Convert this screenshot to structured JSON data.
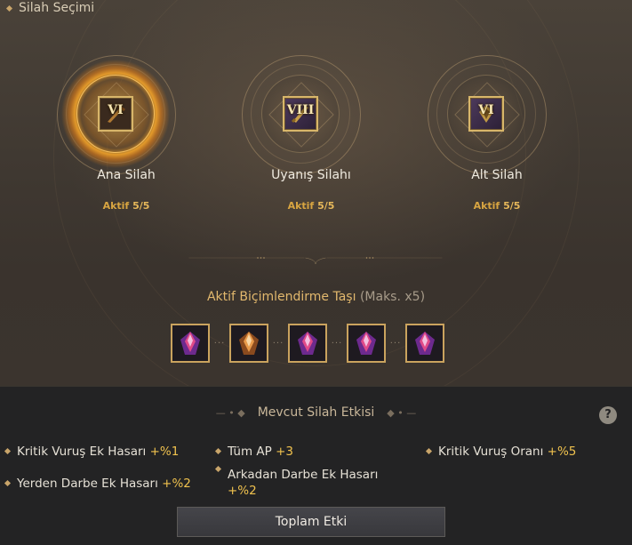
{
  "window": {
    "title": "Silah Seçimi"
  },
  "slots": [
    {
      "label": "Ana Silah",
      "grade": "VI",
      "status_prefix": "Aktif",
      "status_value": "5/5",
      "active": true
    },
    {
      "label": "Uyanış Silahı",
      "grade": "VIII",
      "status_prefix": "Aktif",
      "status_value": "5/5",
      "active": false
    },
    {
      "label": "Alt Silah",
      "grade": "VI",
      "status_prefix": "Aktif",
      "status_value": "5/5",
      "active": false
    }
  ],
  "stones": {
    "title": "Aktif Biçimlendirme Taşı",
    "max": "(Maks. x5)",
    "items": [
      "purple-gem-icon",
      "orange-gem-icon",
      "purple-gem-icon",
      "purple-gem-icon",
      "purple-gem-icon"
    ]
  },
  "effects": {
    "heading": "Mevcut Silah Etkisi",
    "items": [
      {
        "label": "Kritik Vuruş Ek Hasarı",
        "value": "+%1"
      },
      {
        "label": "Tüm AP",
        "value": "+3"
      },
      {
        "label": "Kritik Vuruş Oranı",
        "value": "+%5"
      },
      {
        "label": "Yerden Darbe Ek Hasarı",
        "value": "+%2"
      },
      {
        "label": "Arkadan Darbe Ek Hasarı",
        "value": "+%2"
      }
    ]
  },
  "help_label": "?",
  "total_button": "Toplam Etki",
  "colors": {
    "accent": "#f0c24e",
    "status": "#d8a541",
    "frame": "#caa35e"
  }
}
